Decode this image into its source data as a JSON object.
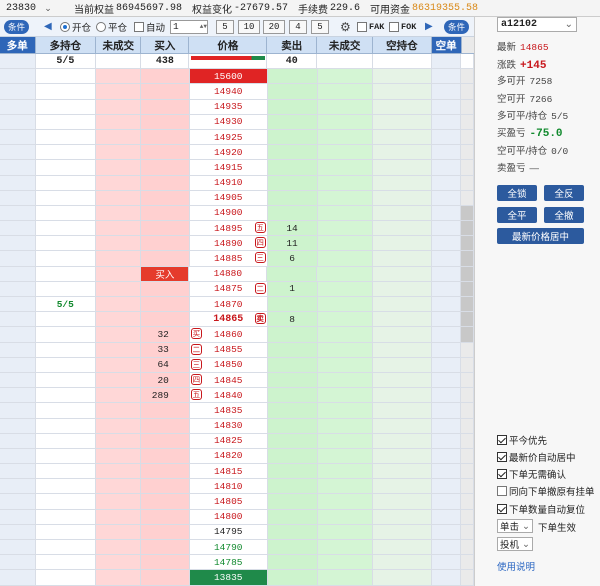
{
  "topbar": {
    "code": "23830",
    "equity_label": "当前权益",
    "equity": "86945697.98",
    "change_label": "权益变化",
    "change": "-27679.57",
    "fee_label": "手续费",
    "fee": "229.6",
    "funds_label": "可用资金",
    "funds": "86319355.58"
  },
  "toolbar": {
    "cond_left": "条件",
    "cond_right": "条件",
    "open_label": "开仓",
    "close_label": "平仓",
    "auto_label": "自动",
    "qty": "1",
    "presets": [
      "5",
      "10",
      "20",
      "4",
      "5"
    ],
    "fak_label": "FAK",
    "fok_label": "FOK"
  },
  "headers": [
    "多单",
    "多持仓",
    "未成交",
    "买入",
    "价格",
    "卖出",
    "未成交",
    "空持仓",
    "空单"
  ],
  "summary": {
    "long_pos": "5/5",
    "buy_total": "438",
    "sell_total": "40"
  },
  "rows": [
    {
      "price": "15600",
      "style": "hi"
    },
    {
      "price": "14940"
    },
    {
      "price": "14935"
    },
    {
      "price": "14930"
    },
    {
      "price": "14925"
    },
    {
      "price": "14920"
    },
    {
      "price": "14915"
    },
    {
      "price": "14910"
    },
    {
      "price": "14905"
    },
    {
      "price": "14900"
    },
    {
      "price": "14895",
      "tag": "五",
      "sell": "14"
    },
    {
      "price": "14890",
      "tag": "四",
      "sell": "11"
    },
    {
      "price": "14885",
      "tag": "三",
      "sell": "6"
    },
    {
      "price": "14880",
      "buy_btn": "买入"
    },
    {
      "price": "14875",
      "tag": "二",
      "sell": "1"
    },
    {
      "price": "14870",
      "pos": "5/5"
    },
    {
      "price": "14865",
      "tag": "卖",
      "sell": "8",
      "style": "bold"
    },
    {
      "price": "14860",
      "btag": "买",
      "buy": "32"
    },
    {
      "price": "14855",
      "btag": "二",
      "buy": "33"
    },
    {
      "price": "14850",
      "btag": "三",
      "buy": "64"
    },
    {
      "price": "14845",
      "btag": "四",
      "buy": "20"
    },
    {
      "price": "14840",
      "btag": "五",
      "buy": "289"
    },
    {
      "price": "14835"
    },
    {
      "price": "14830"
    },
    {
      "price": "14825"
    },
    {
      "price": "14820"
    },
    {
      "price": "14815"
    },
    {
      "price": "14810"
    },
    {
      "price": "14805"
    },
    {
      "price": "14800"
    },
    {
      "price": "14795",
      "style": "black"
    },
    {
      "price": "14790",
      "style": "green"
    },
    {
      "price": "14785",
      "style": "green"
    },
    {
      "price": "13835",
      "style": "lo"
    }
  ],
  "panel": {
    "contract": "a12102",
    "last_label": "最新",
    "last": "14865",
    "chg_label": "涨跌",
    "chg": "+145",
    "long_open_label": "多可开",
    "long_open": "7258",
    "short_open_label": "空可开",
    "short_open": "7266",
    "long_close_label": "多可平/持仓",
    "long_close": "5/5",
    "buy_pnl_label": "买盈亏",
    "buy_pnl": "-75.0",
    "short_close_label": "空可平/持仓",
    "short_close": "0/0",
    "sell_pnl_label": "卖盈亏",
    "sell_pnl": "—",
    "btn_lock": "全锁",
    "btn_reverse": "全反",
    "btn_flat": "全平",
    "btn_cancel": "全撤",
    "btn_center": "最新价格居中",
    "opt1": "平今优先",
    "opt2": "最新价自动居中",
    "opt3": "下单无需确认",
    "opt4": "同向下单撤原有挂单",
    "opt5": "下单数量自动复位",
    "click_mode": "单击",
    "click_suffix": "下单生效",
    "spec": "投机",
    "help": "使用说明"
  }
}
